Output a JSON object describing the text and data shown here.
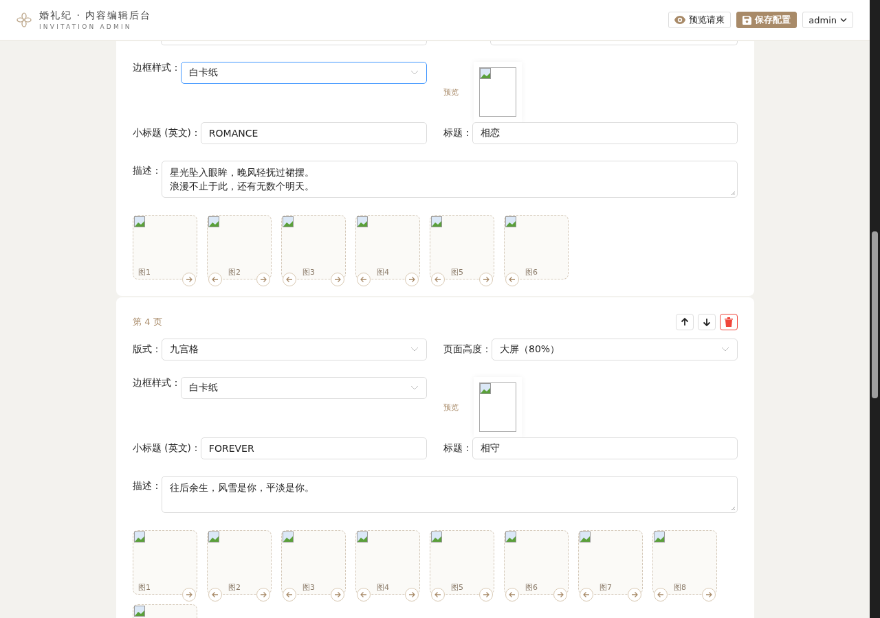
{
  "header": {
    "title": "婚礼纪 · 内容编辑后台",
    "subtitle": "INVITATION ADMIN",
    "preview_button": "预览请柬",
    "save_button": "保存配置",
    "user": "admin"
  },
  "cards": [
    {
      "frame_label": "边框样式：",
      "frame": "白卡纸",
      "frame_focused": true,
      "preview_label": "预览",
      "subtitle_label": "小标题 (英文)：",
      "subtitle": "ROMANCE",
      "title_label": "标题：",
      "title": "相恋",
      "desc_label": "描述：",
      "desc_lines": [
        "星光坠入眼眸，晚风轻抚过裙摆。",
        "浪漫不止于此，还有无数个明天。"
      ],
      "images": [
        {
          "kind": "image",
          "label": "图1"
        },
        {
          "kind": "image",
          "label": "图2"
        },
        {
          "kind": "image",
          "label": "图3"
        },
        {
          "kind": "image",
          "label": "图4"
        },
        {
          "kind": "image",
          "label": "图5"
        },
        {
          "kind": "image",
          "label": "图6"
        }
      ]
    },
    {
      "page": "第 4 页",
      "layout_label": "版式：",
      "layout": "九宫格",
      "height_label": "页面高度：",
      "height": "大屏（80%）",
      "frame_label": "边框样式：",
      "frame": "白卡纸",
      "frame_focused": false,
      "preview_label": "预览",
      "subtitle_label": "小标题 (英文)：",
      "subtitle": "FOREVER",
      "title_label": "标题：",
      "title": "相守",
      "desc_label": "描述：",
      "desc_lines": [
        "往后余生，风雪是你，平淡是你。"
      ],
      "images": [
        {
          "kind": "image",
          "label": "图1"
        },
        {
          "kind": "image",
          "label": "图2"
        },
        {
          "kind": "image",
          "label": "图3"
        },
        {
          "kind": "image",
          "label": "图4"
        },
        {
          "kind": "image",
          "label": "图5"
        },
        {
          "kind": "image",
          "label": "图6"
        },
        {
          "kind": "image",
          "label": "图7"
        },
        {
          "kind": "image",
          "label": "图8"
        },
        {
          "kind": "image"
        }
      ]
    }
  ]
}
